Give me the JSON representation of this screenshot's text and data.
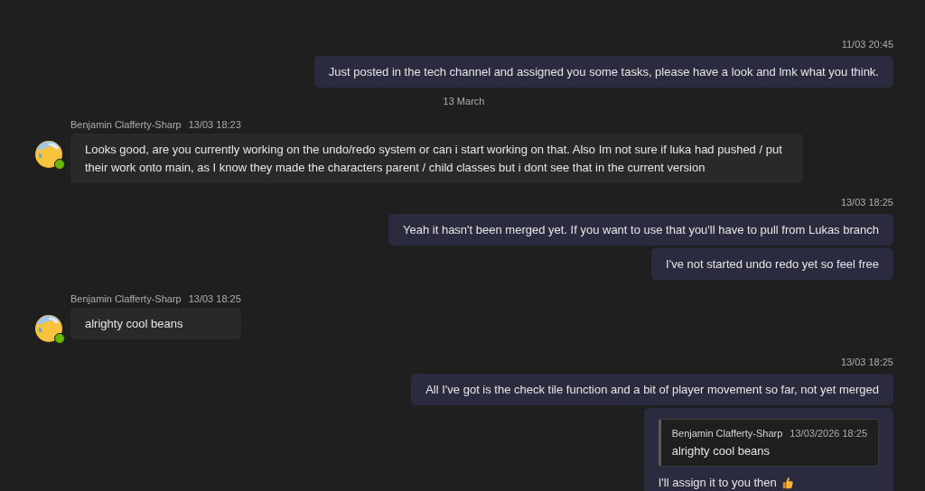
{
  "messages": [
    {
      "kind": "outgoing",
      "time": "11/03 20:45",
      "bubbles": [
        {
          "text": "Just posted in the tech channel and assigned you some tasks, please have a look and lmk what you think."
        }
      ]
    },
    {
      "kind": "date_divider",
      "label": "13 March"
    },
    {
      "kind": "incoming",
      "author": "Benjamin Clafferty-Sharp",
      "time": "13/03 18:23",
      "online": true,
      "bubbles": [
        {
          "text": "Looks good, are you currently working on the undo/redo system or can i start working on that. Also Im not sure if luka had pushed / put their work onto main, as I know they made the characters parent / child classes but i dont see that in the current version"
        }
      ]
    },
    {
      "kind": "outgoing",
      "time": "13/03 18:25",
      "bubbles": [
        {
          "text": "Yeah it hasn't been merged yet. If you want to use that you'll have to pull from Lukas branch"
        },
        {
          "text": "I've not started undo redo yet so feel free"
        }
      ]
    },
    {
      "kind": "incoming",
      "author": "Benjamin Clafferty-Sharp",
      "time": "13/03 18:25",
      "online": true,
      "bubbles": [
        {
          "text": "alrighty cool beans"
        }
      ]
    },
    {
      "kind": "outgoing",
      "time": "13/03 18:25",
      "bubbles": [
        {
          "text": "All I've got is the check tile function and a bit of player movement so far, not yet merged"
        },
        {
          "quote": {
            "author": "Benjamin Clafferty-Sharp",
            "time": "13/03/2026 18:25",
            "text": "alrighty cool beans"
          },
          "text": "I'll assign it to you then",
          "thumbs_up": true
        }
      ]
    }
  ]
}
